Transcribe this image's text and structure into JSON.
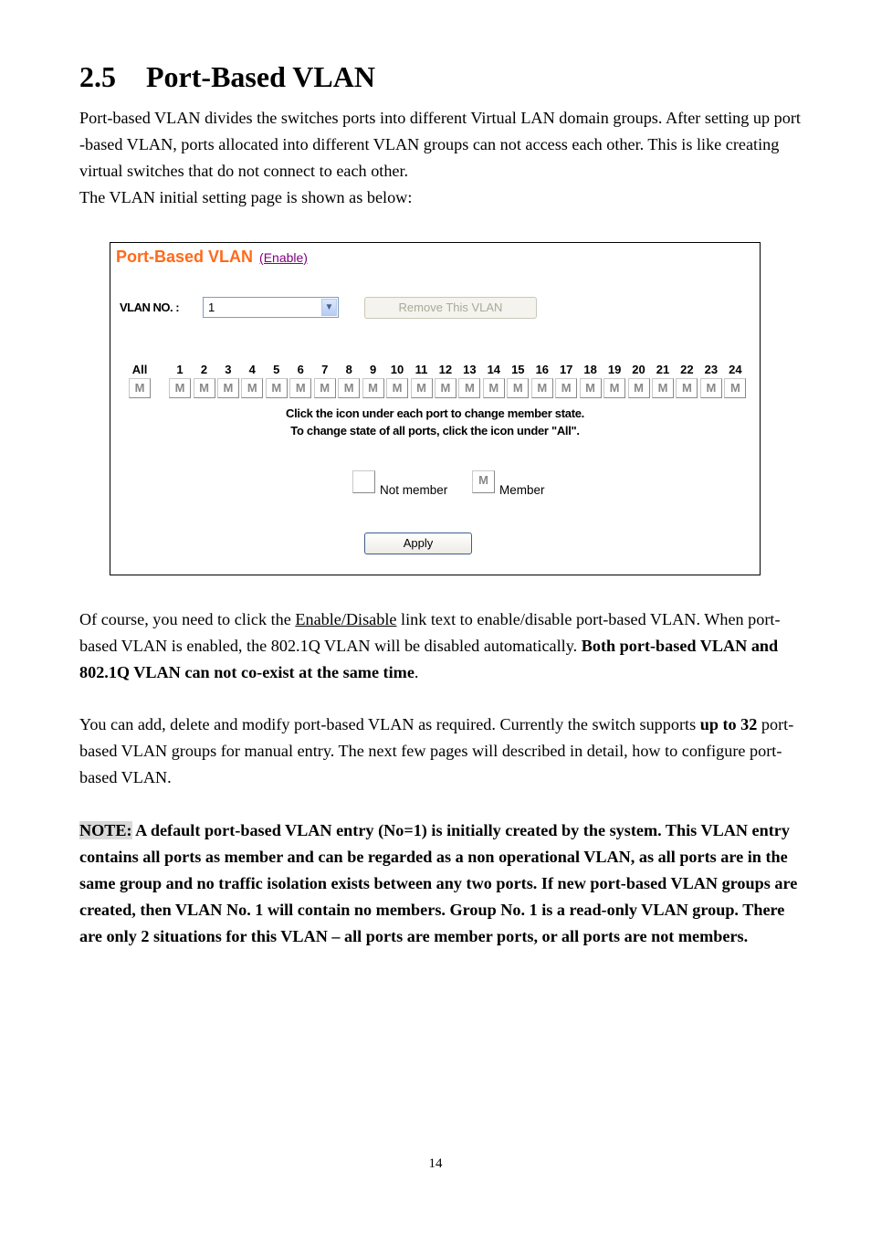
{
  "section": {
    "number": "2.5",
    "title": "Port-Based VLAN"
  },
  "intro": {
    "line": "Port-based VLAN divides the switches ports into different Virtual LAN domain groups. After setting up port -based VLAN, ports allocated into different VLAN groups can not access each other. This is like creating virtual switches that do not connect to each other.",
    "line2": "The VLAN initial setting page is shown as below:"
  },
  "panel": {
    "title": "Port-Based VLAN",
    "enable_link": "(Enable)",
    "vlan_no_label": "VLAN NO. :",
    "vlan_no_value": "1",
    "dropdown_icon": "chevron-down-icon",
    "remove_button": "Remove This VLAN",
    "remove_button_disabled": true,
    "all_label": "All",
    "all_state": "M",
    "ports": [
      {
        "label": "1",
        "state": "M"
      },
      {
        "label": "2",
        "state": "M"
      },
      {
        "label": "3",
        "state": "M"
      },
      {
        "label": "4",
        "state": "M"
      },
      {
        "label": "5",
        "state": "M"
      },
      {
        "label": "6",
        "state": "M"
      },
      {
        "label": "7",
        "state": "M"
      },
      {
        "label": "8",
        "state": "M"
      },
      {
        "label": "9",
        "state": "M"
      },
      {
        "label": "10",
        "state": "M"
      },
      {
        "label": "11",
        "state": "M"
      },
      {
        "label": "12",
        "state": "M"
      },
      {
        "label": "13",
        "state": "M"
      },
      {
        "label": "14",
        "state": "M"
      },
      {
        "label": "15",
        "state": "M"
      },
      {
        "label": "16",
        "state": "M"
      },
      {
        "label": "17",
        "state": "M"
      },
      {
        "label": "18",
        "state": "M"
      },
      {
        "label": "19",
        "state": "M"
      },
      {
        "label": "20",
        "state": "M"
      },
      {
        "label": "21",
        "state": "M"
      },
      {
        "label": "22",
        "state": "M"
      },
      {
        "label": "23",
        "state": "M"
      },
      {
        "label": "24",
        "state": "M"
      }
    ],
    "hint1": "Click the icon under each port to change member state.",
    "hint2": "To change state of all ports, click the icon under \"All\".",
    "legend_not_member": "Not member",
    "legend_member_icon": "M",
    "legend_member": "Member",
    "apply_button": "Apply",
    "colors": {
      "title": "#ff6a1a",
      "link": "#800080",
      "disabled_text": "#aca899"
    }
  },
  "para2": {
    "a": "Of course, you need to click the ",
    "link": "Enable/Disable",
    "b": " link text to enable/disable port-based VLAN. When port-based VLAN is enabled, the 802.1Q VLAN will be disabled automatically. ",
    "bold": "Both port-based VLAN and 802.1Q VLAN can not co-exist at the same time",
    "c": "."
  },
  "para3": {
    "a": "You can add, delete and modify port-based VLAN as required. Currently the switch supports ",
    "bold": "up to 32",
    "b": " port-based VLAN groups for manual entry. The next few pages will described in detail, how to configure port-based VLAN."
  },
  "note": {
    "label": "NOTE:",
    "text": " A default port-based VLAN entry (No=1) is initially created by the system. This VLAN entry contains all ports as member and can be regarded as a non operational VLAN, as all ports are in the same group and no traffic isolation exists between any two ports. If new port-based VLAN groups are created, then VLAN No. 1 will contain no members. Group No. 1 is a read-only VLAN group. There are only 2 situations for this VLAN – all ports are member ports, or all ports are not members."
  },
  "page_number": "14"
}
